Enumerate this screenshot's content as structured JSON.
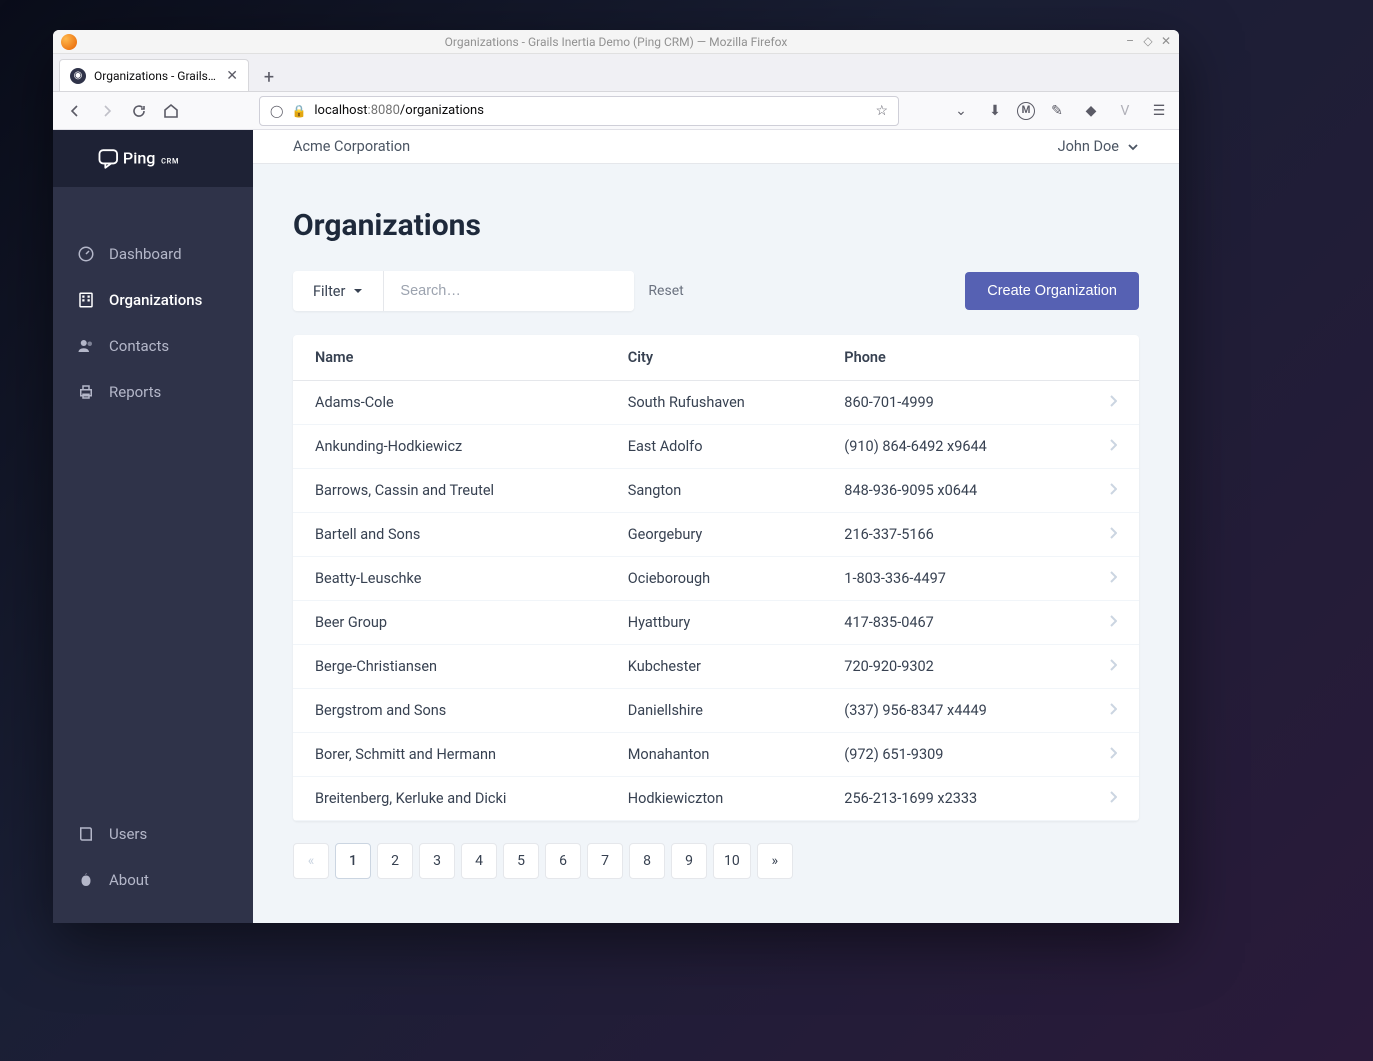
{
  "window": {
    "title": "Organizations - Grails Inertia Demo (Ping CRM) — Mozilla Firefox"
  },
  "tab": {
    "title": "Organizations - Grails Inert"
  },
  "url": {
    "host": "localhost",
    "port": ":8080",
    "path": "/organizations"
  },
  "brand": {
    "name": "Ping",
    "suffix": "CRM"
  },
  "sidebar": {
    "items": [
      {
        "label": "Dashboard",
        "icon": "gauge-icon"
      },
      {
        "label": "Organizations",
        "icon": "building-icon"
      },
      {
        "label": "Contacts",
        "icon": "users-icon"
      },
      {
        "label": "Reports",
        "icon": "printer-icon"
      }
    ],
    "bottom": [
      {
        "label": "Users",
        "icon": "book-icon"
      },
      {
        "label": "About",
        "icon": "apple-icon"
      }
    ]
  },
  "topbar": {
    "org": "Acme Corporation",
    "user": "John Doe"
  },
  "page": {
    "title": "Organizations",
    "filter_label": "Filter",
    "search_placeholder": "Search…",
    "reset_label": "Reset",
    "create_label": "Create Organization"
  },
  "table": {
    "headers": {
      "name": "Name",
      "city": "City",
      "phone": "Phone"
    },
    "rows": [
      {
        "name": "Adams-Cole",
        "city": "South Rufushaven",
        "phone": "860-701-4999"
      },
      {
        "name": "Ankunding-Hodkiewicz",
        "city": "East Adolfo",
        "phone": "(910) 864-6492 x9644"
      },
      {
        "name": "Barrows, Cassin and Treutel",
        "city": "Sangton",
        "phone": "848-936-9095 x0644"
      },
      {
        "name": "Bartell and Sons",
        "city": "Georgebury",
        "phone": "216-337-5166"
      },
      {
        "name": "Beatty-Leuschke",
        "city": "Ocieborough",
        "phone": "1-803-336-4497"
      },
      {
        "name": "Beer Group",
        "city": "Hyattbury",
        "phone": "417-835-0467"
      },
      {
        "name": "Berge-Christiansen",
        "city": "Kubchester",
        "phone": "720-920-9302"
      },
      {
        "name": "Bergstrom and Sons",
        "city": "Daniellshire",
        "phone": "(337) 956-8347 x4449"
      },
      {
        "name": "Borer, Schmitt and Hermann",
        "city": "Monahanton",
        "phone": "(972) 651-9309"
      },
      {
        "name": "Breitenberg, Kerluke and Dicki",
        "city": "Hodkiewiczton",
        "phone": "256-213-1699 x2333"
      }
    ]
  },
  "pagination": {
    "prev": "«",
    "next": "»",
    "pages": [
      "1",
      "2",
      "3",
      "4",
      "5",
      "6",
      "7",
      "8",
      "9",
      "10"
    ],
    "active": "1"
  }
}
